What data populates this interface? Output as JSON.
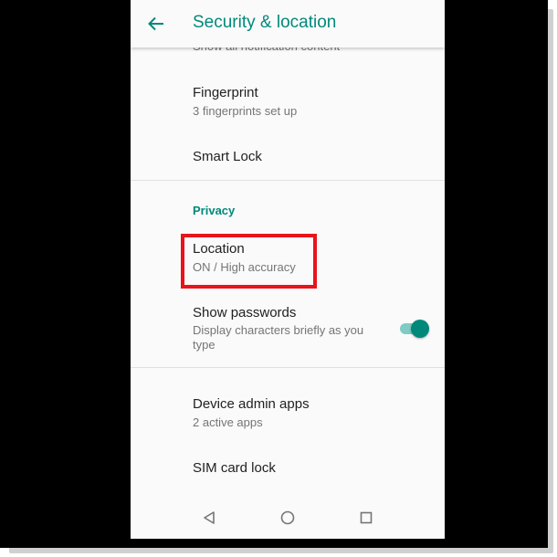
{
  "header": {
    "title": "Security & location",
    "back_icon": "arrow-back-icon"
  },
  "cut_item": {
    "summary": "Show all notification content"
  },
  "security_items": [
    {
      "title": "Fingerprint",
      "summary": "3 fingerprints set up"
    },
    {
      "title": "Smart Lock"
    }
  ],
  "privacy": {
    "header": "Privacy",
    "location": {
      "title": "Location",
      "summary": "ON / High accuracy"
    },
    "show_passwords": {
      "title": "Show passwords",
      "summary": "Display characters briefly as you type",
      "toggle_state": "on"
    }
  },
  "admin_items": [
    {
      "title": "Device admin apps",
      "summary": "2 active apps"
    },
    {
      "title": "SIM card lock"
    }
  ],
  "navbar": {
    "back_icon": "triangle-back-icon",
    "home_icon": "circle-home-icon",
    "recents_icon": "square-recents-icon"
  },
  "colors": {
    "accent": "#00897b",
    "highlight": "#e8141a",
    "background": "#fafafa",
    "frame": "#000000"
  }
}
